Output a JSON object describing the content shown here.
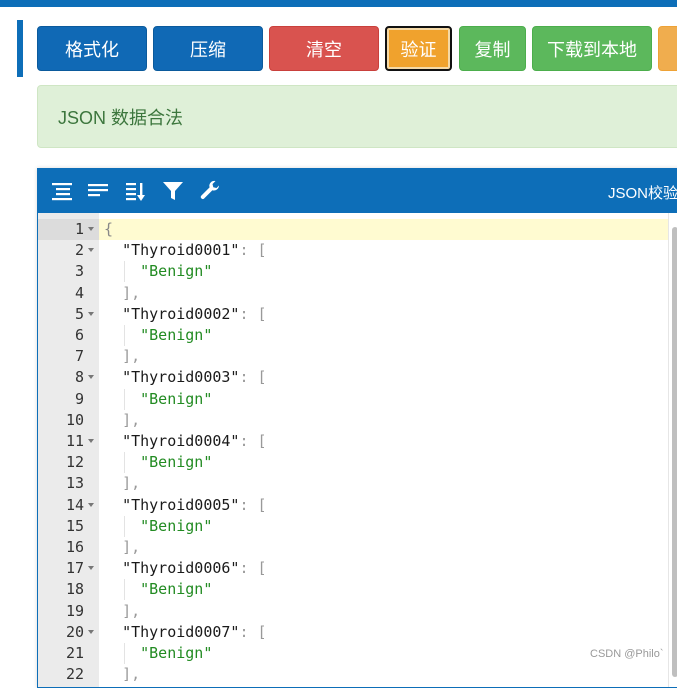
{
  "toolbar": {
    "format_label": "格式化",
    "compress_label": "压缩",
    "clear_label": "清空",
    "validate_label": "验证",
    "copy_label": "复制",
    "download_label": "下载到本地",
    "more_label": ""
  },
  "alert": {
    "message": "JSON 数据合法"
  },
  "editor": {
    "menu_title": "JSON校验",
    "tools": [
      "format-icon",
      "compact-icon",
      "sort-icon",
      "filter-icon",
      "repair-icon"
    ],
    "lines": [
      {
        "n": "1",
        "fold": true,
        "active": true,
        "tokens": [
          {
            "t": "{",
            "c": "b"
          }
        ]
      },
      {
        "n": "2",
        "fold": true,
        "tokens": [
          {
            "t": "  "
          },
          {
            "t": "\"Thyroid0001\"",
            "c": "k"
          },
          {
            "t": ": [",
            "c": "p"
          }
        ]
      },
      {
        "n": "3",
        "tokens": [
          {
            "t": "    "
          },
          {
            "t": "\"Benign\"",
            "c": "s"
          }
        ]
      },
      {
        "n": "4",
        "tokens": [
          {
            "t": "  "
          },
          {
            "t": "],",
            "c": "p"
          }
        ]
      },
      {
        "n": "5",
        "fold": true,
        "tokens": [
          {
            "t": "  "
          },
          {
            "t": "\"Thyroid0002\"",
            "c": "k"
          },
          {
            "t": ": [",
            "c": "p"
          }
        ]
      },
      {
        "n": "6",
        "tokens": [
          {
            "t": "    "
          },
          {
            "t": "\"Benign\"",
            "c": "s"
          }
        ]
      },
      {
        "n": "7",
        "tokens": [
          {
            "t": "  "
          },
          {
            "t": "],",
            "c": "p"
          }
        ]
      },
      {
        "n": "8",
        "fold": true,
        "tokens": [
          {
            "t": "  "
          },
          {
            "t": "\"Thyroid0003\"",
            "c": "k"
          },
          {
            "t": ": [",
            "c": "p"
          }
        ]
      },
      {
        "n": "9",
        "tokens": [
          {
            "t": "    "
          },
          {
            "t": "\"Benign\"",
            "c": "s"
          }
        ]
      },
      {
        "n": "10",
        "tokens": [
          {
            "t": "  "
          },
          {
            "t": "],",
            "c": "p"
          }
        ]
      },
      {
        "n": "11",
        "fold": true,
        "tokens": [
          {
            "t": "  "
          },
          {
            "t": "\"Thyroid0004\"",
            "c": "k"
          },
          {
            "t": ": [",
            "c": "p"
          }
        ]
      },
      {
        "n": "12",
        "tokens": [
          {
            "t": "    "
          },
          {
            "t": "\"Benign\"",
            "c": "s"
          }
        ]
      },
      {
        "n": "13",
        "tokens": [
          {
            "t": "  "
          },
          {
            "t": "],",
            "c": "p"
          }
        ]
      },
      {
        "n": "14",
        "fold": true,
        "tokens": [
          {
            "t": "  "
          },
          {
            "t": "\"Thyroid0005\"",
            "c": "k"
          },
          {
            "t": ": [",
            "c": "p"
          }
        ]
      },
      {
        "n": "15",
        "tokens": [
          {
            "t": "    "
          },
          {
            "t": "\"Benign\"",
            "c": "s"
          }
        ]
      },
      {
        "n": "16",
        "tokens": [
          {
            "t": "  "
          },
          {
            "t": "],",
            "c": "p"
          }
        ]
      },
      {
        "n": "17",
        "fold": true,
        "tokens": [
          {
            "t": "  "
          },
          {
            "t": "\"Thyroid0006\"",
            "c": "k"
          },
          {
            "t": ": [",
            "c": "p"
          }
        ]
      },
      {
        "n": "18",
        "tokens": [
          {
            "t": "    "
          },
          {
            "t": "\"Benign\"",
            "c": "s"
          }
        ]
      },
      {
        "n": "19",
        "tokens": [
          {
            "t": "  "
          },
          {
            "t": "],",
            "c": "p"
          }
        ]
      },
      {
        "n": "20",
        "fold": true,
        "tokens": [
          {
            "t": "  "
          },
          {
            "t": "\"Thyroid0007\"",
            "c": "k"
          },
          {
            "t": ": [",
            "c": "p"
          }
        ]
      },
      {
        "n": "21",
        "tokens": [
          {
            "t": "    "
          },
          {
            "t": "\"Benign\"",
            "c": "s"
          }
        ]
      },
      {
        "n": "22",
        "tokens": [
          {
            "t": "  "
          },
          {
            "t": "],",
            "c": "p"
          }
        ]
      }
    ]
  },
  "watermark": "CSDN @Philo`",
  "colors": {
    "primary": "#0d6eb8",
    "danger": "#d9534f",
    "warning": "#f0a22d",
    "success": "#5cb85c",
    "alert_bg": "#dff0d8",
    "alert_text": "#3c763d",
    "string": "#228b22"
  }
}
